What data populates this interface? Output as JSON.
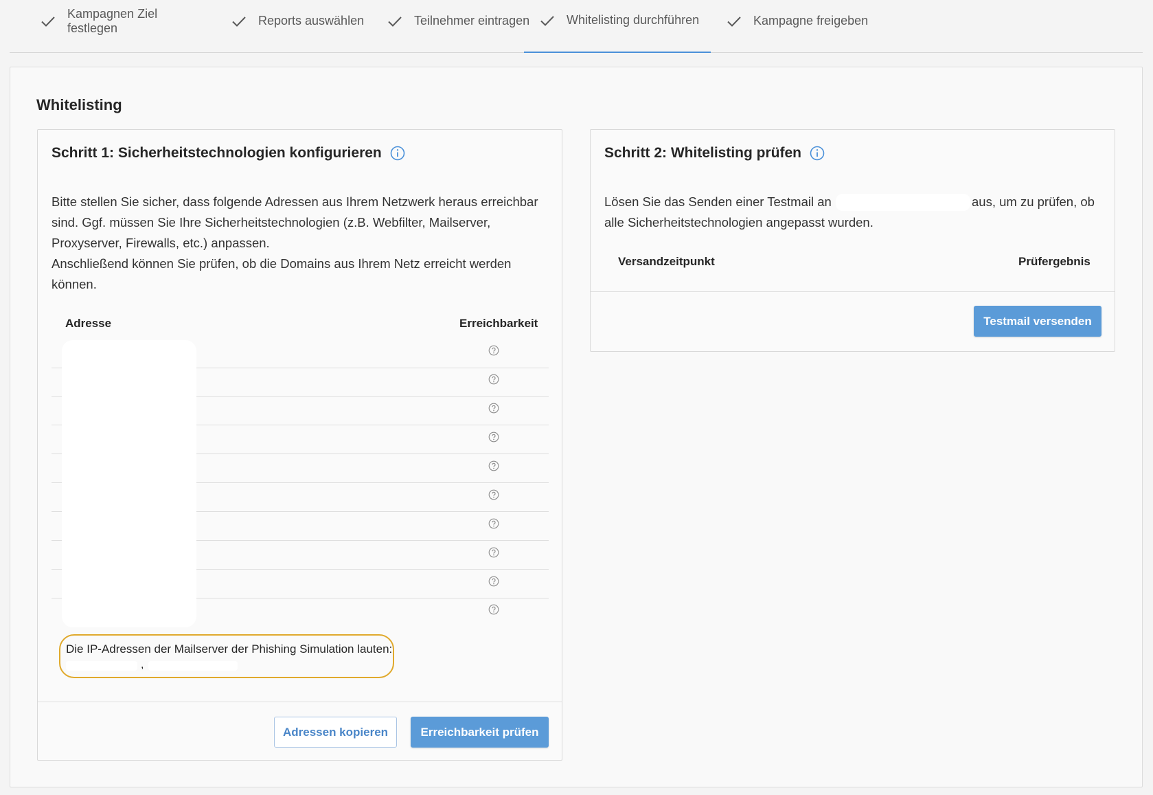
{
  "stepper": {
    "steps": [
      {
        "label": "Kampagnen Ziel festlegen",
        "icon": "check-icon"
      },
      {
        "label": "Reports auswählen",
        "icon": "check-icon"
      },
      {
        "label": "Teilnehmer eintragen",
        "icon": "check-icon"
      },
      {
        "label": "Whitelisting durchführen",
        "icon": "check-icon",
        "active": true
      },
      {
        "label": "Kampagne freigeben",
        "icon": "check-icon"
      }
    ]
  },
  "page": {
    "title": "Whitelisting"
  },
  "step1": {
    "title": "Schritt 1: Sicherheitstechnologien konfigurieren",
    "line1": "Bitte stellen Sie sicher, dass folgende Adressen aus Ihrem Netzwerk heraus erreichbar",
    "line2": "sind. Ggf. müssen Sie Ihre Sicherheitstechnologien (z.B. Webfilter, Mailserver,",
    "line3": "Proxyserver, Firewalls, etc.) anpassen.",
    "line4": "Anschließend können Sie prüfen, ob die Domains aus Ihrem Netz erreicht werden",
    "line5": "können.",
    "col_address": "Adresse",
    "col_reachability": "Erreichbarkeit",
    "ip_note": "Die IP-Adressen der Mailserver der Phishing Simulation lauten:",
    "ip_separator": ",",
    "btn_copy": "Adressen kopieren",
    "btn_check": "Erreichbarkeit prüfen"
  },
  "step2": {
    "title": "Schritt 2: Whitelisting prüfen",
    "line1_pre": "Lösen Sie das Senden einer Testmail an",
    "line1_post": "aus, um zu prüfen, ob",
    "line2": "alle Sicherheitstechnologien angepasst wurden.",
    "col_time": "Versandzeitpunkt",
    "col_result": "Prüfergebnis",
    "btn_send": "Testmail versenden"
  },
  "colors": {
    "accent": "#5b9bd8",
    "highlight_box": "#e0a92c",
    "active_tab_underline": "#4a90d9"
  }
}
